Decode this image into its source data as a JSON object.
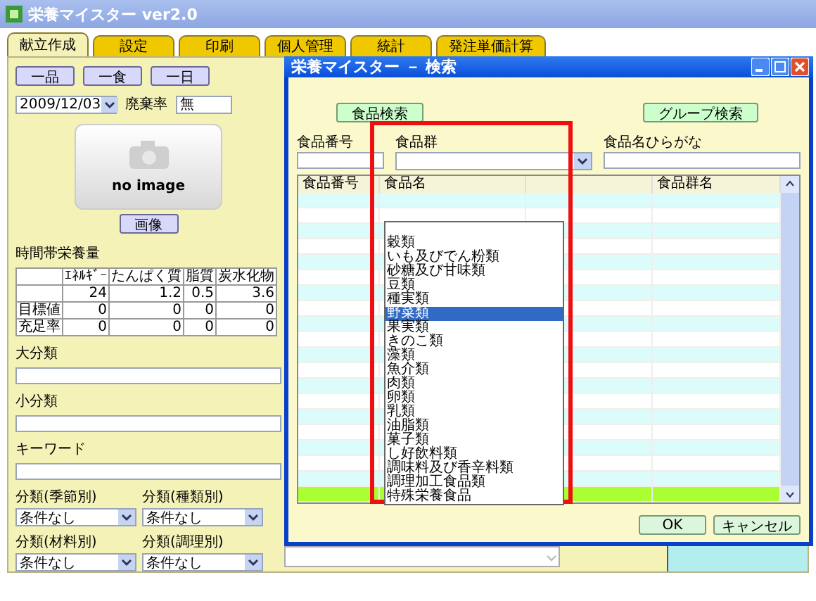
{
  "app_window": {
    "title": "栄養マイスター ver2.0"
  },
  "tabs": [
    {
      "label": "献立作成",
      "selected": true
    },
    {
      "label": "設定",
      "selected": false
    },
    {
      "label": "印刷",
      "selected": false
    },
    {
      "label": "個人管理",
      "selected": false
    },
    {
      "label": "統計",
      "selected": false
    },
    {
      "label": "発注単価計算",
      "selected": false
    }
  ],
  "meal_buttons": [
    "一品",
    "一食",
    "一日"
  ],
  "date": {
    "value": "2009/12/03"
  },
  "waste_rate": {
    "label": "廃棄率",
    "value": "無"
  },
  "image": {
    "caption": "no image",
    "button": "画像"
  },
  "nutrition": {
    "title": "時間帯栄養量",
    "columns": [
      "ｴﾈﾙｷﾞｰ",
      "たんぱく質",
      "脂質",
      "炭水化物"
    ],
    "rows": [
      {
        "cells": [
          "24",
          "1.2",
          "0.5",
          "3.6"
        ]
      },
      {
        "label": "目標値",
        "cells": [
          "0",
          "0",
          "0",
          "0"
        ]
      },
      {
        "label": "充足率",
        "cells": [
          "0",
          "0",
          "0",
          "0"
        ]
      }
    ]
  },
  "text_fields": [
    {
      "label": "大分類"
    },
    {
      "label": "小分類"
    },
    {
      "label": "キーワード"
    }
  ],
  "category_filters": [
    {
      "label": "分類(季節別)",
      "value": "条件なし"
    },
    {
      "label": "分類(種類別)",
      "value": "条件なし"
    },
    {
      "label": "分類(材料別)",
      "value": "条件なし"
    },
    {
      "label": "分類(調理別)",
      "value": "条件なし"
    }
  ],
  "dialog": {
    "title": "栄養マイスター － 検索",
    "food_search_button": "食品検索",
    "group_search_button": "グループ検索",
    "number_label": "食品番号",
    "group_label": "食品群",
    "kana_label": "食品名ひらがな",
    "column_headers": {
      "food_number": "食品番号",
      "food_name": "食品名",
      "food_group_name": "食品群名"
    },
    "result_rows": [
      {
        "selected": false
      },
      {
        "selected": false
      },
      {
        "selected": false
      },
      {
        "selected": false
      },
      {
        "selected": false
      },
      {
        "selected": false
      },
      {
        "selected": false
      },
      {
        "selected": false
      },
      {
        "selected": false
      },
      {
        "selected": false
      },
      {
        "selected": false
      },
      {
        "selected": false
      },
      {
        "selected": false
      },
      {
        "selected": false
      },
      {
        "selected": false
      },
      {
        "selected": false
      },
      {
        "selected": false
      },
      {
        "selected": false
      },
      {
        "selected": false
      },
      {
        "selected": true
      }
    ],
    "ok_button": "OK",
    "cancel_button": "キャンセル"
  },
  "group_dropdown": {
    "items": [
      {
        "label": "穀類",
        "selected": false
      },
      {
        "label": "いも及びでん粉類",
        "selected": false
      },
      {
        "label": "砂糖及び甘味類",
        "selected": false
      },
      {
        "label": "豆類",
        "selected": false
      },
      {
        "label": "種実類",
        "selected": false
      },
      {
        "label": "野菜類",
        "selected": true
      },
      {
        "label": "果実類",
        "selected": false
      },
      {
        "label": "きのこ類",
        "selected": false
      },
      {
        "label": "藻類",
        "selected": false
      },
      {
        "label": "魚介類",
        "selected": false
      },
      {
        "label": "肉類",
        "selected": false
      },
      {
        "label": "卵類",
        "selected": false
      },
      {
        "label": "乳類",
        "selected": false
      },
      {
        "label": "油脂類",
        "selected": false
      },
      {
        "label": "菓子類",
        "selected": false
      },
      {
        "label": "し好飲料類",
        "selected": false
      },
      {
        "label": "調味料及び香辛料類",
        "selected": false
      },
      {
        "label": "調理加工食品類",
        "selected": false
      },
      {
        "label": "特殊栄養食品",
        "selected": false
      }
    ]
  }
}
